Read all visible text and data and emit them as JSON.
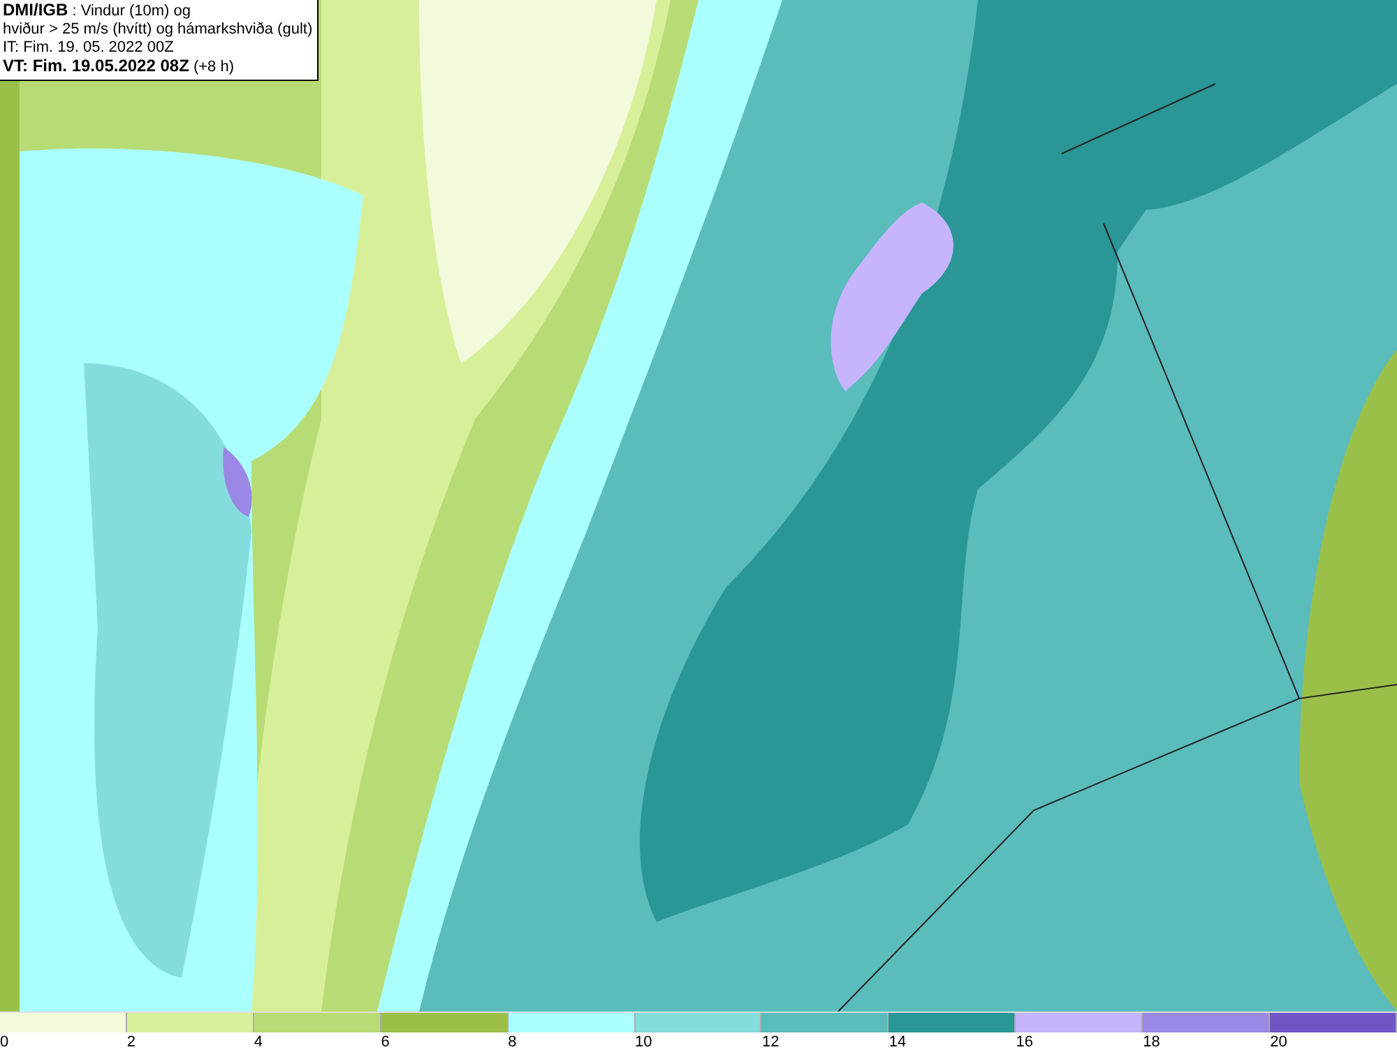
{
  "title_box": {
    "lines": [
      "**DMI/IGB** : Vindur (10m) og",
      "hviður > 25 m/s (hvítt) og hámarkshviða (gult)",
      "IT: Fim. 19. 05. 2022 00Z",
      "**VT: Fim. 19.05.2022 08Z** (+8 h)"
    ]
  },
  "legend": {
    "segments": [
      {
        "color": "#f3fadc"
      },
      {
        "color": "#d8ef9a"
      },
      {
        "color": "#b8dc75"
      },
      {
        "color": "#9bc04a"
      },
      {
        "color": "#aaffff"
      },
      {
        "color": "#85dcdc"
      },
      {
        "color": "#5bbcbc"
      },
      {
        "color": "#2a9696"
      },
      {
        "color": "#c6b4ff"
      },
      {
        "color": "#9b87e6"
      },
      {
        "color": "#7055c4"
      }
    ],
    "labels": [
      "0",
      "2",
      "4",
      "6",
      "8",
      "10",
      "12",
      "14",
      "16",
      "18",
      "20"
    ]
  }
}
